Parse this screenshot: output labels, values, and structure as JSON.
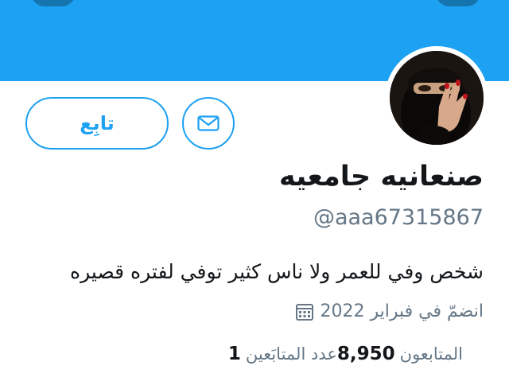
{
  "colors": {
    "accent": "#1da1f2",
    "text_primary": "#14171a",
    "text_secondary": "#657786",
    "banner": "#1da1f2"
  },
  "header": {
    "banner_left_icon": "back-arrow-icon",
    "banner_right_icon": "more-options-icon"
  },
  "profile": {
    "avatar_icon": "profile-photo",
    "follow_label": "تابِع",
    "message_icon": "envelope-icon",
    "display_name": "صنعانيه جامعيه",
    "handle": "@aaa67315867",
    "bio": "شخص وفي للعمر ولا ناس كثير توفي لفتره قصيره",
    "joined_icon": "calendar-icon",
    "joined_text": "انضمّ في فبراير 2022"
  },
  "stats": {
    "following_count": "1",
    "following_label": "عدد المتابَعين",
    "followers_count": "8,950",
    "followers_label": "المتابعون"
  }
}
